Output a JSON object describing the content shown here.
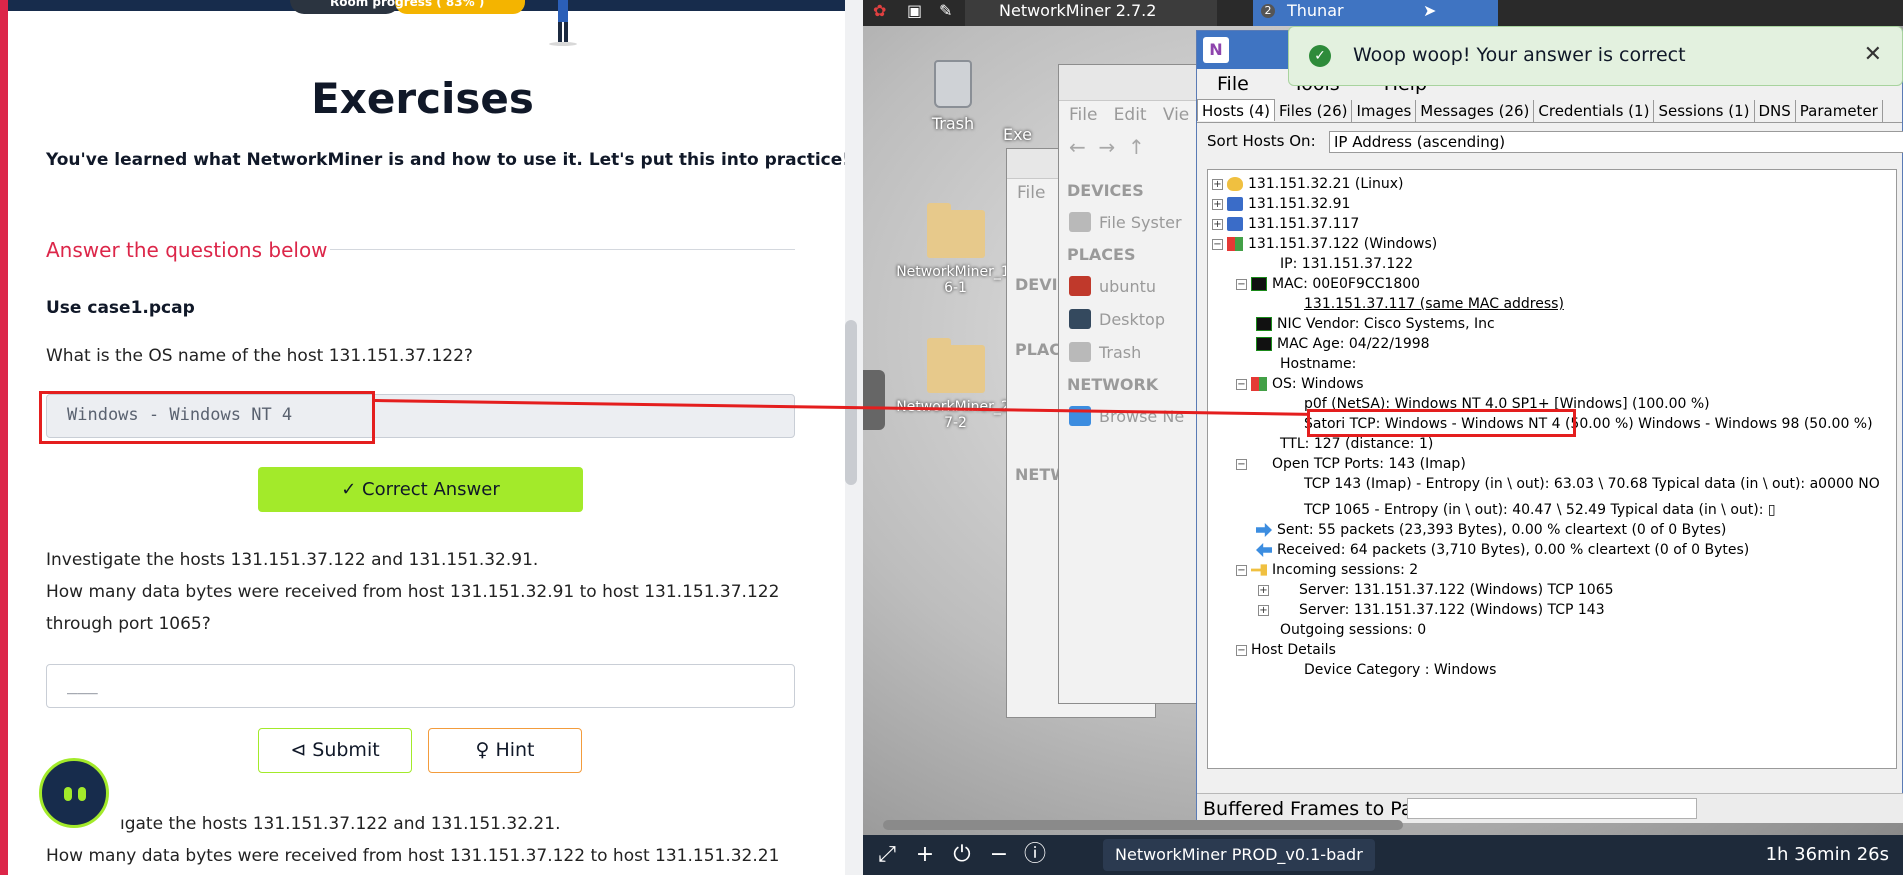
{
  "course": {
    "progress_label": "Room progress ( 83% )",
    "title": "Exercises",
    "intro": "You've learned what NetworkMiner is and how to use it. Let's put this into practice!",
    "answer_heading": "Answer the questions below",
    "use_file": "Use case1.pcap",
    "q1": "What is the OS name of the host 131.151.37.122?",
    "q1_answer": "Windows - Windows NT 4",
    "correct_button": "✓ Correct Answer",
    "q2_line1": "Investigate the hosts 131.151.37.122 and 131.151.32.91.",
    "q2_line2": "How many data bytes were received from host 131.151.32.91 to host 131.151.37.122",
    "q2_line3": "through port 1065?",
    "q2_placeholder": "___",
    "submit_button": "⊲ Submit",
    "hint_button": "♀ Hint",
    "q3_line1": "Investigate the hosts 131.151.37.122 and 131.151.32.21.",
    "q3_line1_visible": "ıgate the hosts 131.151.37.122 and 131.151.32.21.",
    "q3_line2": "How many data bytes were received from host 131.151.37.122 to host 131.151.32.21"
  },
  "desktop": {
    "taskbar": {
      "tasks": [
        "NetworkMiner 2.7.2",
        "Thunar"
      ],
      "thunar_count": "2"
    },
    "icons": [
      "Trash",
      "NetworkMiner_1-6-1",
      "NetworkMiner_2-7-2"
    ],
    "icon_partials": {
      "exe": "Exe"
    },
    "thunar": {
      "menu": [
        "File",
        "Edit",
        "Vie"
      ],
      "back_menu": "File",
      "devices": "DEVICES",
      "file_system": "File Syster",
      "places": "PLACES",
      "home": "ubuntu",
      "desktop": "Desktop",
      "trash": "Trash",
      "network": "NETWORK",
      "browse": "Browse Ne",
      "back_headers": [
        "DEVI",
        "PLAC",
        "NETW"
      ]
    },
    "networkminer": {
      "menu": [
        "File",
        "Tools",
        "Help"
      ],
      "tabs": [
        "Hosts (4)",
        "Files (26)",
        "Images",
        "Messages (26)",
        "Credentials (1)",
        "Sessions (1)",
        "DNS",
        "Parameter"
      ],
      "sort_label": "Sort Hosts On:",
      "sort_value": "IP Address (ascending)",
      "tree": [
        "131.151.32.21 (Linux)",
        "131.151.32.91",
        "131.151.37.117",
        "131.151.37.122 (Windows)",
        "IP: 131.151.37.122",
        "MAC: 00E0F9CC1800",
        "131.151.37.117 (same MAC address)",
        "NIC Vendor: Cisco Systems, Inc",
        "MAC Age: 04/22/1998",
        "Hostname:",
        "OS: Windows",
        "p0f (NetSA): Windows NT 4.0 SP1+ [Windows] (100.00 %)",
        "Satori TCP: Windows - Windows NT 4 (50.00 %) Windows - Windows 98 (50.00 %)",
        "TTL: 127 (distance: 1)",
        "Open TCP Ports: 143 (Imap)",
        "TCP 143 (Imap) - Entropy (in \\ out): 63.03 \\ 70.68 Typical data (in \\ out): a0000 NO",
        "TCP 1065 - Entropy (in \\ out): 40.47 \\ 52.49 Typical data (in \\ out): ▯",
        "Sent: 55 packets (23,393 Bytes), 0.00 % cleartext (0 of 0 Bytes)",
        "Received: 64 packets (3,710 Bytes), 0.00 % cleartext (0 of 0 Bytes)",
        "Incoming sessions: 2",
        "Server: 131.151.37.122 (Windows) TCP 1065",
        "Server: 131.151.37.122 (Windows) TCP 143",
        "Outgoing sessions: 0",
        "Host Details",
        "Device Category : Windows"
      ],
      "bottom_label": "Buffered Frames to Parse:"
    },
    "toast": "Woop woop! Your answer is correct",
    "bottom_bar": {
      "task": "NetworkMiner PROD_v0.1-badr",
      "timer": "1h 36min 26s"
    }
  }
}
